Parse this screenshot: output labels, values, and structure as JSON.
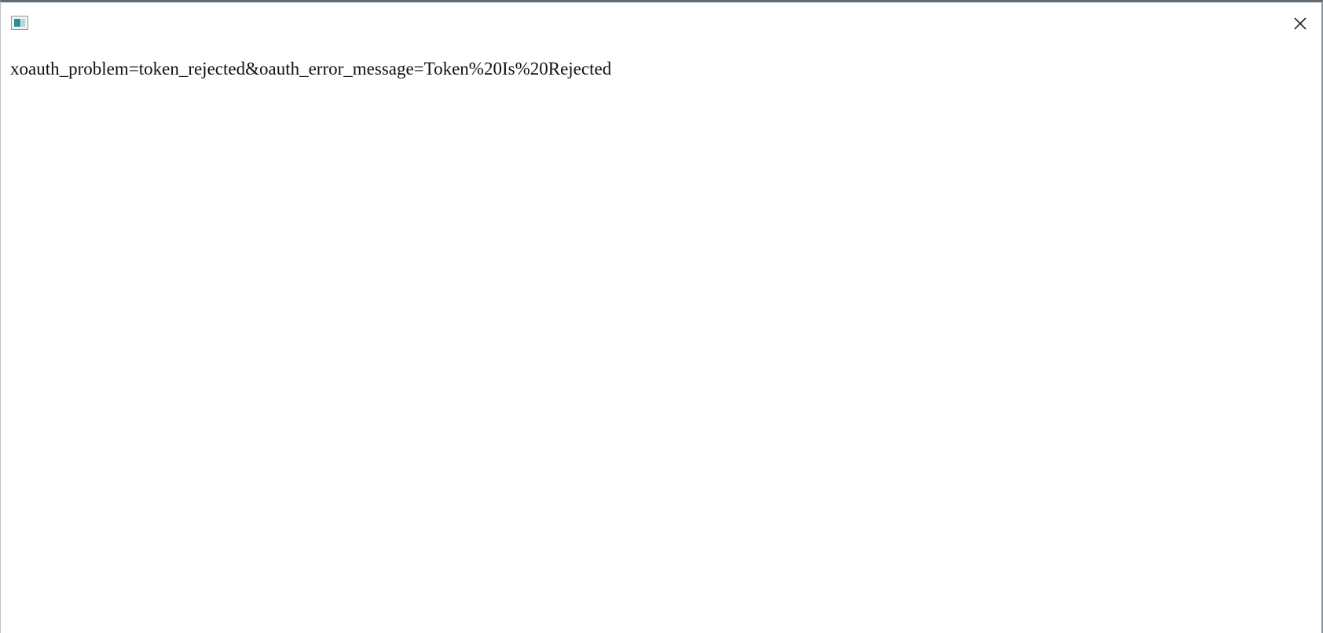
{
  "window": {
    "icon": "app-window-icon",
    "close_icon": "close-icon"
  },
  "content": {
    "response_text": "xoauth_problem=token_rejected&oauth_error_message=Token%20Is%20Rejected"
  }
}
